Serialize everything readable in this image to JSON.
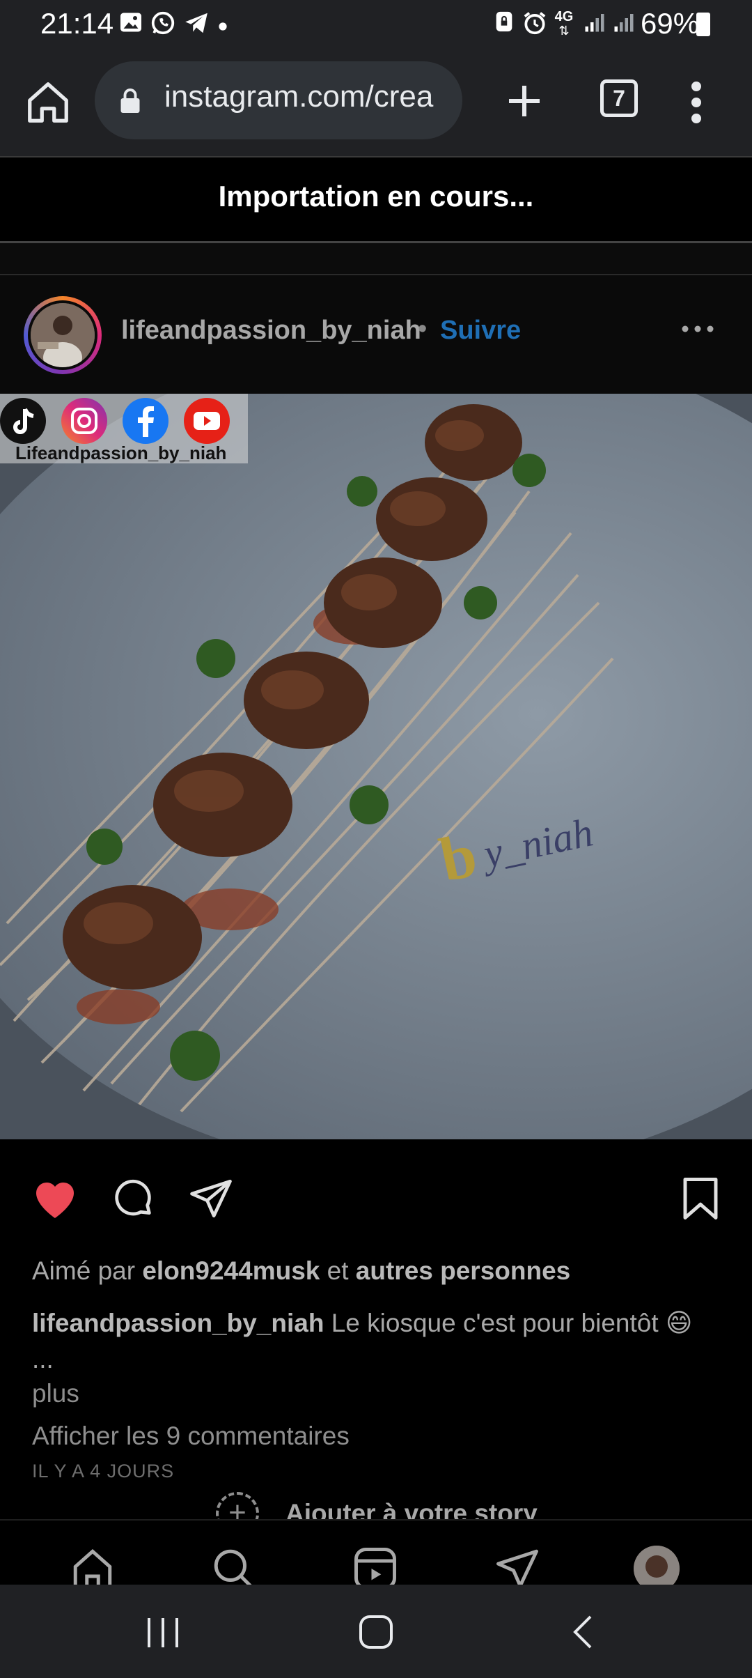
{
  "status_bar": {
    "time": "21:14",
    "network": "4G",
    "battery_percent": "69%",
    "icons": [
      "gallery-icon",
      "whatsapp-icon",
      "telegram-icon",
      "notification-dot-icon",
      "lock-screen-icon",
      "alarm-icon",
      "network-4g-icon",
      "signal-icon",
      "signal-icon",
      "battery-icon"
    ]
  },
  "browser": {
    "url": "instagram.com/crea",
    "tab_count": "7",
    "icons": [
      "home-icon",
      "lock-icon",
      "plus-icon",
      "tabs-icon",
      "more-vertical-icon"
    ]
  },
  "banner": {
    "text": "Importation en cours..."
  },
  "post": {
    "username": "lifeandpassion_by_niah",
    "separator": "•",
    "follow_label": "Suivre",
    "image": {
      "social_label": "Lifeandpassion_by_niah",
      "social_icons": [
        "tiktok-icon",
        "instagram-icon",
        "facebook-icon",
        "youtube-icon"
      ],
      "watermark": "by_niah"
    },
    "liked": true,
    "likes": {
      "prefix": "Aimé par",
      "user": "elon9244musk",
      "connector": "et",
      "others": "autres personnes"
    },
    "caption": {
      "username": "lifeandpassion_by_niah",
      "text": "Le kiosque c'est pour bientôt 😄",
      "ellipsis": "...",
      "more_label": "plus"
    },
    "view_comments": "Afficher les 9 commentaires",
    "timestamp": "IL Y A 4 JOURS",
    "add_story_label": "Ajouter à votre story"
  },
  "colors": {
    "like_red": "#ed4956",
    "follow_blue": "#1f6fb5",
    "chrome_bar": "#202124"
  }
}
